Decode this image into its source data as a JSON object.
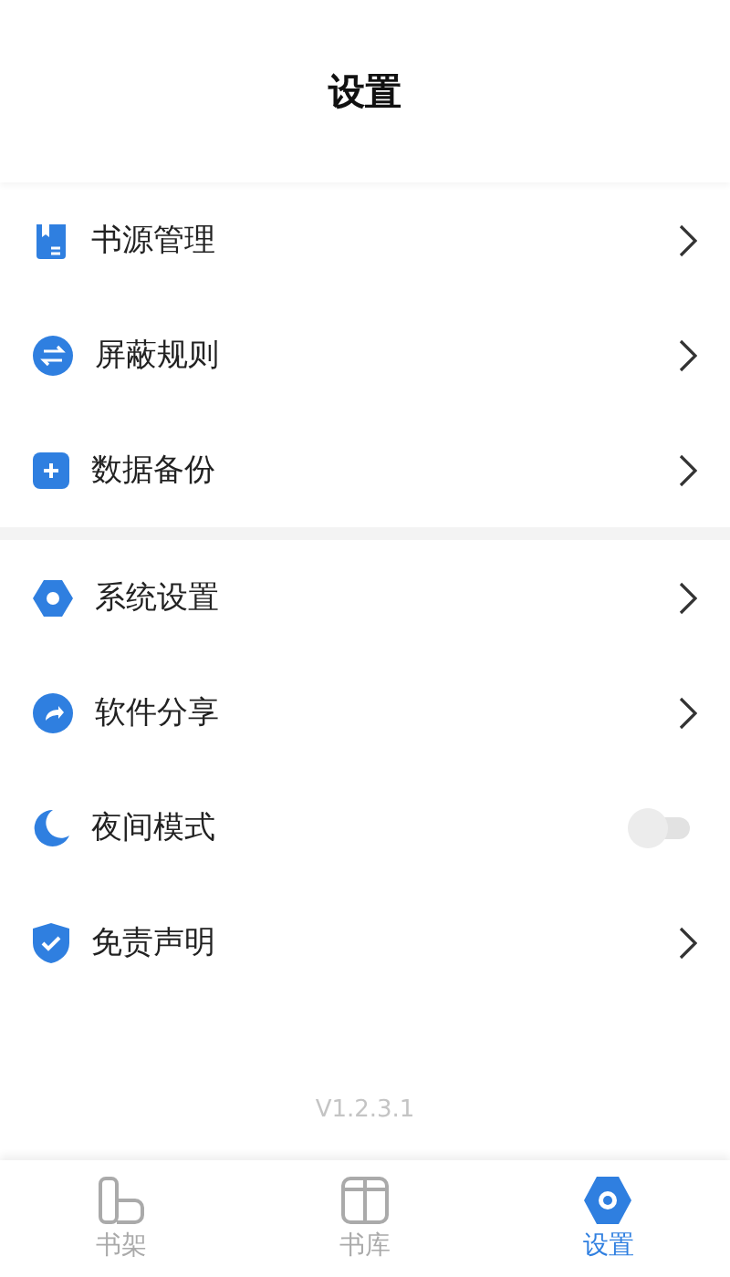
{
  "header": {
    "title": "设置"
  },
  "sections": [
    {
      "items": [
        {
          "kind": "link",
          "label": "书源管理"
        },
        {
          "kind": "link",
          "label": "屏蔽规则"
        },
        {
          "kind": "link",
          "label": "数据备份"
        }
      ]
    },
    {
      "items": [
        {
          "kind": "link",
          "label": "系统设置"
        },
        {
          "kind": "link",
          "label": "软件分享"
        },
        {
          "kind": "toggle",
          "label": "夜间模式",
          "on": false
        },
        {
          "kind": "link",
          "label": "免责声明"
        }
      ]
    }
  ],
  "version": "V1.2.3.1",
  "tabs": [
    {
      "label": "书架",
      "selected": false
    },
    {
      "label": "书库",
      "selected": false
    },
    {
      "label": "设置",
      "selected": true
    }
  ]
}
